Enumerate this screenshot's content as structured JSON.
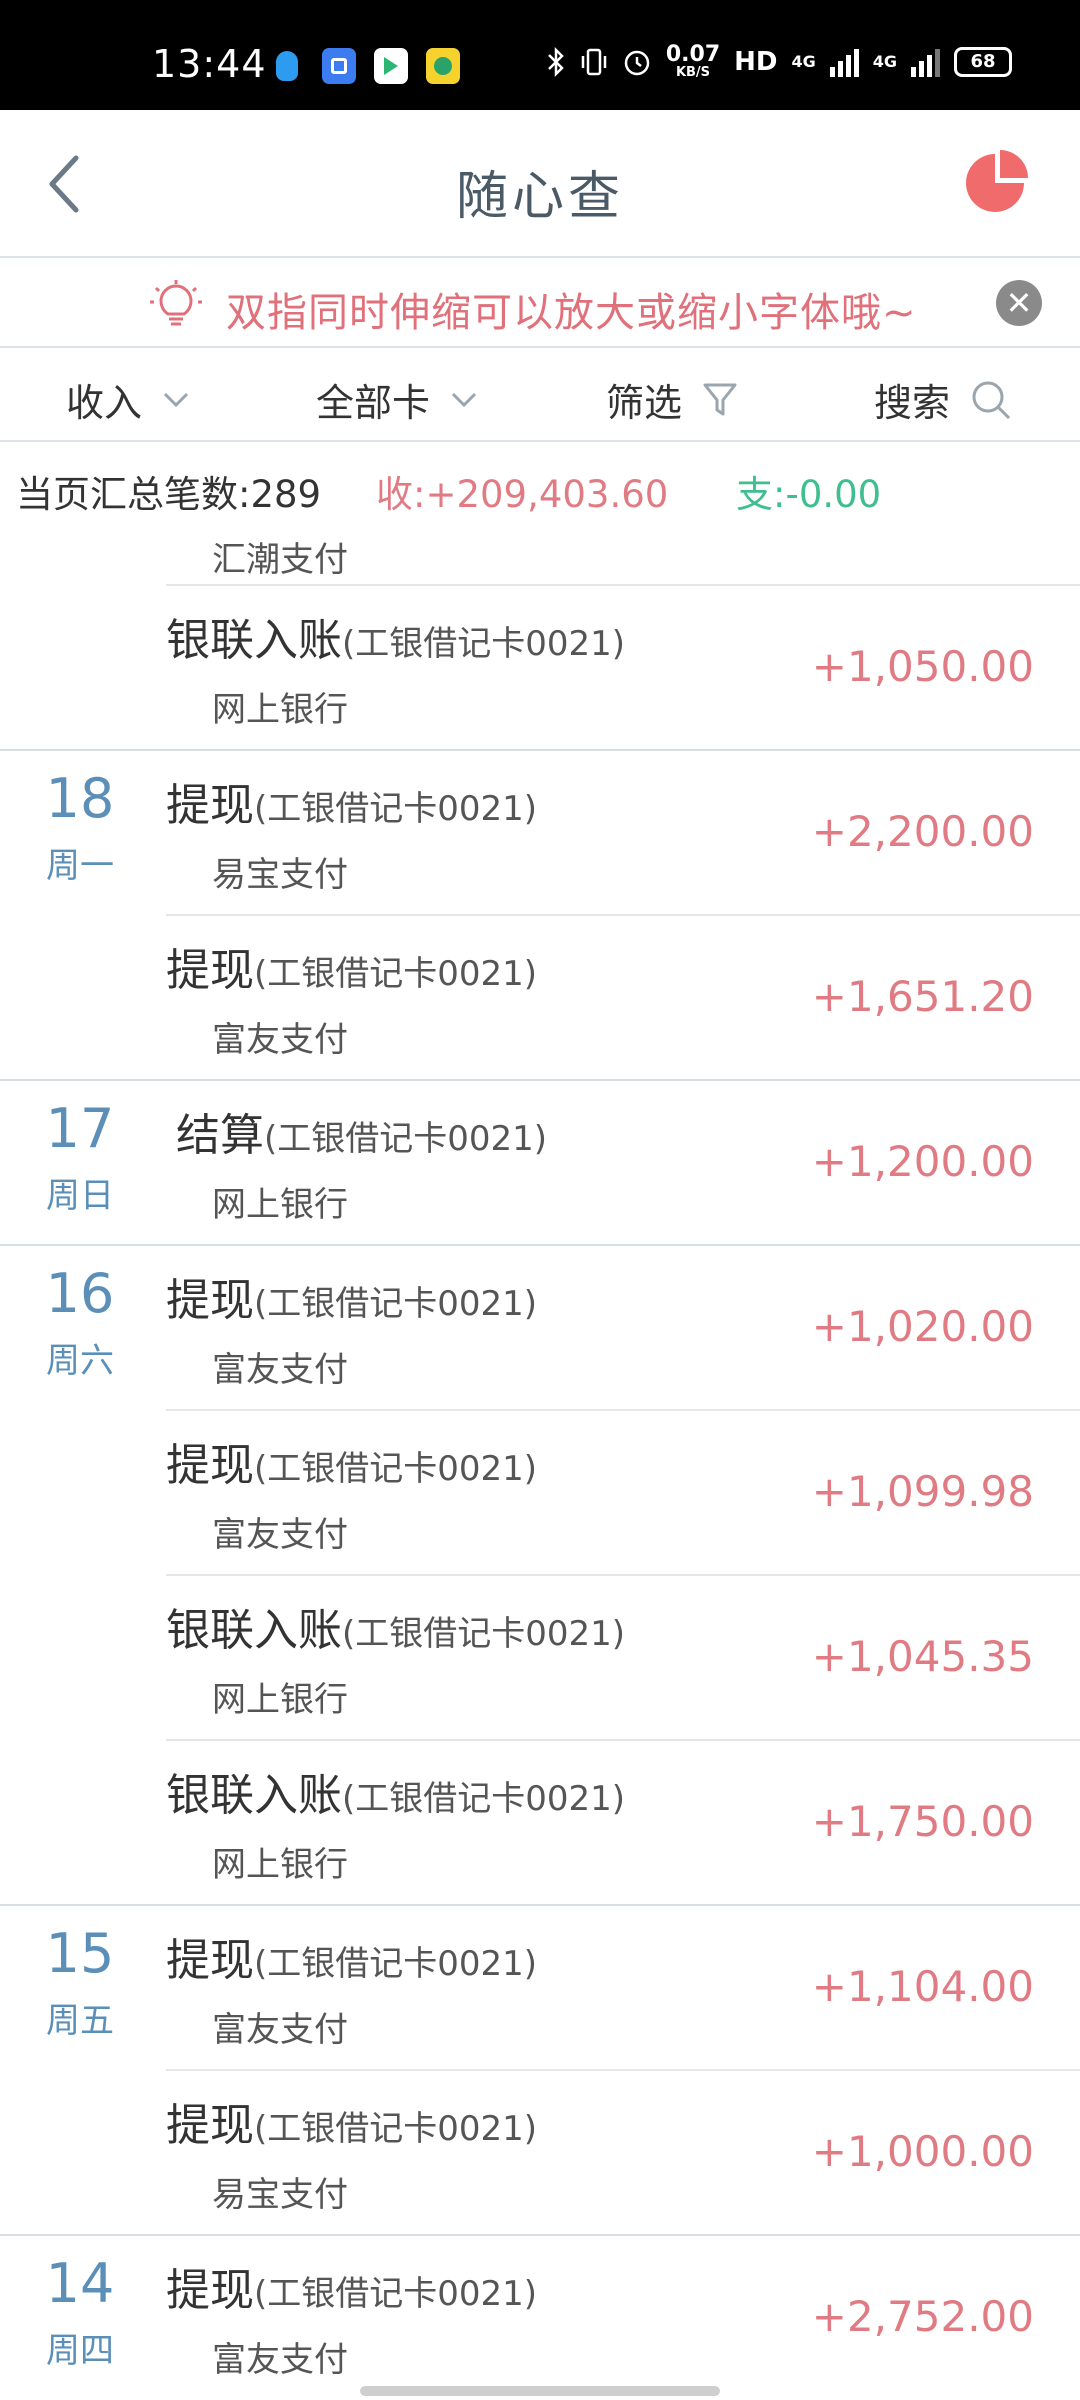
{
  "status_bar": {
    "time": "13:44",
    "net_speed": "0.07",
    "net_unit": "KB/S",
    "hd_label": "HD",
    "net1": "4G",
    "net2": "4G",
    "battery": "68",
    "icons": [
      "qq-icon",
      "app-blue-icon",
      "video-app-icon",
      "music-app-icon",
      "bluetooth-icon",
      "vibrate-icon",
      "alarm-icon",
      "signal-icon",
      "battery-icon"
    ]
  },
  "header": {
    "title": "随心查"
  },
  "tip": {
    "text": "双指同时伸缩可以放大或缩小字体哦~"
  },
  "filters": {
    "income": "收入",
    "cards": "全部卡",
    "filter": "筛选",
    "search": "搜索"
  },
  "summary": {
    "count": "当页汇总笔数:289",
    "income": "收:+209,403.60",
    "expense": "支:-0.00"
  },
  "list": {
    "partial_sub": "汇潮支付",
    "rows": [
      {
        "day": "",
        "weekday": "",
        "title": "银联入账",
        "card": "(工银借记卡0021)",
        "sub": "网上银行",
        "amount": "+1,050.00"
      },
      {
        "day": "18",
        "weekday": "周一",
        "title": "提现",
        "card": "(工银借记卡0021)",
        "sub": "易宝支付",
        "amount": "+2,200.00"
      },
      {
        "day": "",
        "weekday": "",
        "title": "提现",
        "card": "(工银借记卡0021)",
        "sub": "富友支付",
        "amount": "+1,651.20"
      },
      {
        "day": "17",
        "weekday": "周日",
        "title": "结算",
        "card": "(工银借记卡0021)",
        "sub": "网上银行",
        "amount": "+1,200.00"
      },
      {
        "day": "16",
        "weekday": "周六",
        "title": "提现",
        "card": "(工银借记卡0021)",
        "sub": "富友支付",
        "amount": "+1,020.00"
      },
      {
        "day": "",
        "weekday": "",
        "title": "提现",
        "card": "(工银借记卡0021)",
        "sub": "富友支付",
        "amount": "+1,099.98"
      },
      {
        "day": "",
        "weekday": "",
        "title": "银联入账",
        "card": "(工银借记卡0021)",
        "sub": "网上银行",
        "amount": "+1,045.35"
      },
      {
        "day": "",
        "weekday": "",
        "title": "银联入账",
        "card": "(工银借记卡0021)",
        "sub": "网上银行",
        "amount": "+1,750.00"
      },
      {
        "day": "15",
        "weekday": "周五",
        "title": "提现",
        "card": "(工银借记卡0021)",
        "sub": "富友支付",
        "amount": "+1,104.00"
      },
      {
        "day": "",
        "weekday": "",
        "title": "提现",
        "card": "(工银借记卡0021)",
        "sub": "易宝支付",
        "amount": "+1,000.00"
      },
      {
        "day": "14",
        "weekday": "周四",
        "title": "提现",
        "card": "(工银借记卡0021)",
        "sub": "富友支付",
        "amount": "+2,752.00"
      }
    ]
  },
  "colors": {
    "income": "#e07b83",
    "expense": "#3fbf8f",
    "date": "#5b8fb8",
    "tip": "#e0707a",
    "pie": "#f06c6c"
  }
}
